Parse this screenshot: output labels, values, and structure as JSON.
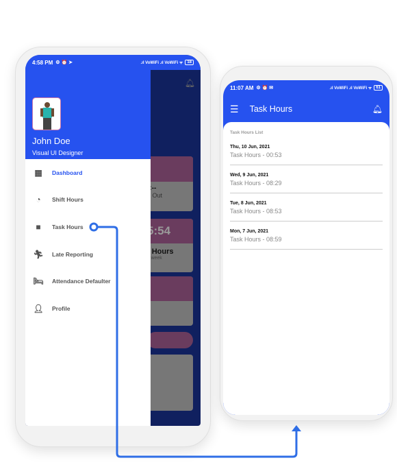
{
  "left_phone": {
    "status": {
      "time": "4:58 PM",
      "battery": "18"
    },
    "drawer": {
      "user_name": "John Doe",
      "user_role": "Visual UI Designer",
      "items": [
        {
          "label": "Dashboard",
          "icon": "dashboard-icon",
          "active": true
        },
        {
          "label": "Shift Hours",
          "icon": "clock-icon"
        },
        {
          "label": "Task Hours",
          "icon": "briefcase-icon"
        },
        {
          "label": "Late Reporting",
          "icon": "run-icon"
        },
        {
          "label": "Attendance Defaulter",
          "icon": "bed-icon"
        },
        {
          "label": "Profile",
          "icon": "person-icon"
        }
      ]
    },
    "background": {
      "clock_out": "-:--",
      "clock_out_label": "n Out",
      "time": "5:54",
      "hours_label": "t Hours",
      "hours_sub": "s week"
    }
  },
  "right_phone": {
    "status": {
      "time": "11:07 AM",
      "battery": "61"
    },
    "app_bar": {
      "title": "Task Hours"
    },
    "list_title": "Task Hours List",
    "entries": [
      {
        "date": "Thu, 10 Jun, 2021",
        "value": "Task Hours - 00:53"
      },
      {
        "date": "Wed, 9 Jun, 2021",
        "value": "Task Hours - 08:29"
      },
      {
        "date": "Tue, 8 Jun, 2021",
        "value": "Task Hours - 08:53"
      },
      {
        "date": "Mon, 7 Jun, 2021",
        "value": "Task Hours - 08:59"
      }
    ]
  },
  "colors": {
    "primary": "#2652ef",
    "connector": "#2f6ee6"
  }
}
